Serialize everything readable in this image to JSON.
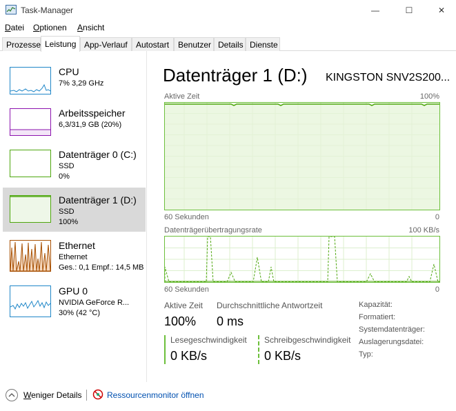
{
  "window": {
    "title": "Task-Manager",
    "min_glyph": "—",
    "max_glyph": "☐",
    "close_glyph": "✕"
  },
  "menu": [
    {
      "key": "D",
      "rest": "atei"
    },
    {
      "key": "O",
      "rest": "ptionen"
    },
    {
      "key": "A",
      "rest": "nsicht"
    }
  ],
  "tabs": [
    "Prozesse",
    "Leistung",
    "App-Verlauf",
    "Autostart",
    "Benutzer",
    "Details",
    "Dienste"
  ],
  "sidebar": {
    "items": [
      {
        "title": "CPU",
        "line1": "7%  3,29 GHz",
        "line2": "",
        "line3": "",
        "color": "#1e86c8"
      },
      {
        "title": "Arbeitsspeicher",
        "line1": "6,3/31,9 GB (20%)",
        "line2": "",
        "line3": "",
        "color": "#8b12ae"
      },
      {
        "title": "Datenträger 0 (C:)",
        "line1": "SSD",
        "line2": "0%",
        "line3": "",
        "color": "#4da60c"
      },
      {
        "title": "Datenträger 1 (D:)",
        "line1": "SSD",
        "line2": "100%",
        "line3": "",
        "color": "#4da60c"
      },
      {
        "title": "Ethernet",
        "line1": "Ethernet",
        "line2": "Ges.: 0,1  Empf.: 14,5 MB",
        "line3": "",
        "color": "#a74f01"
      },
      {
        "title": "GPU 0",
        "line1": "NVIDIA GeForce R...",
        "line2": "30% (42 °C)",
        "line3": "",
        "color": "#1e86c8"
      }
    ]
  },
  "main": {
    "title": "Datenträger 1 (D:)",
    "model": "KINGSTON SNV2S200...",
    "graph1": {
      "label": "Aktive Zeit",
      "max": "100%",
      "time_label": "60 Sekunden",
      "min": "0"
    },
    "graph2": {
      "label": "Datenträgerübertragungsrate",
      "max": "100 KB/s",
      "time_label": "60 Sekunden",
      "min": "0"
    },
    "stats": {
      "active_time_label": "Aktive Zeit",
      "active_time_value": "100%",
      "response_label": "Durchschnittliche Antwortzeit",
      "response_value": "0 ms",
      "read_label": "Lesegeschwindigkeit",
      "read_value": "0 KB/s",
      "write_label": "Schreibgeschwindigkeit",
      "write_value": "0 KB/s"
    },
    "properties": [
      "Kapazität:",
      "Formatiert:",
      "Systemdatenträger:",
      "Auslagerungsdatei:",
      "Typ:"
    ]
  },
  "footer": {
    "fewer_key": "W",
    "fewer_rest": "eniger Details",
    "resource_monitor": "Ressourcenmonitor öffnen"
  },
  "colors": {
    "disk_green": "#4da60c",
    "link_blue": "#0050b0",
    "selected_bg": "#d9d9d9"
  }
}
